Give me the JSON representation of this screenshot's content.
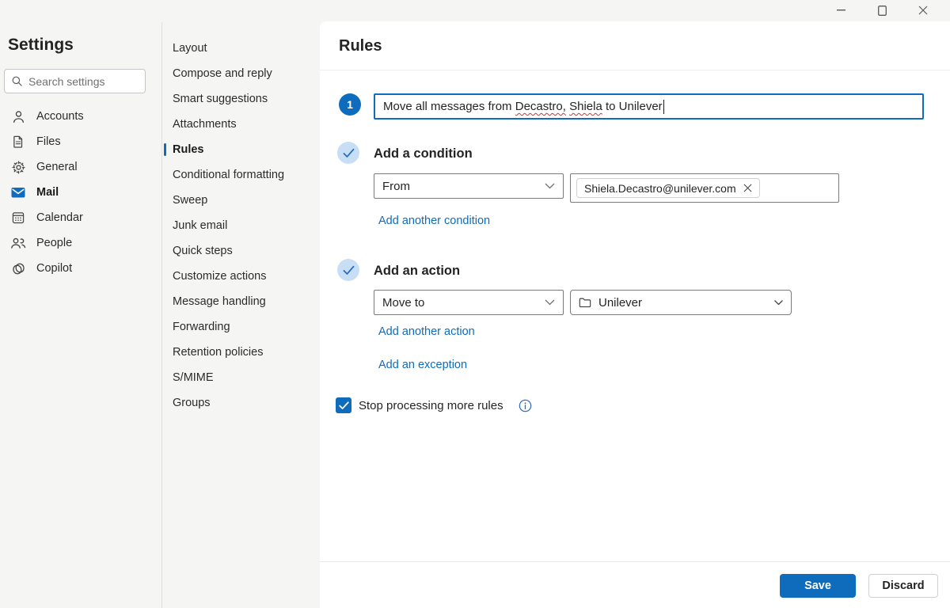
{
  "window": {
    "controls": [
      "minimize",
      "maximize",
      "close"
    ]
  },
  "settings_nav": {
    "title": "Settings",
    "search_placeholder": "Search settings",
    "items": [
      {
        "label": "Accounts",
        "icon": "person-icon",
        "selected": false
      },
      {
        "label": "Files",
        "icon": "file-icon",
        "selected": false
      },
      {
        "label": "General",
        "icon": "gear-icon",
        "selected": false
      },
      {
        "label": "Mail",
        "icon": "mail-icon",
        "selected": true
      },
      {
        "label": "Calendar",
        "icon": "calendar-icon",
        "selected": false
      },
      {
        "label": "People",
        "icon": "people-icon",
        "selected": false
      },
      {
        "label": "Copilot",
        "icon": "copilot-icon",
        "selected": false
      }
    ]
  },
  "mail_nav": {
    "items": [
      "Layout",
      "Compose and reply",
      "Smart suggestions",
      "Attachments",
      "Rules",
      "Conditional formatting",
      "Sweep",
      "Junk email",
      "Quick steps",
      "Customize actions",
      "Message handling",
      "Forwarding",
      "Retention policies",
      "S/MIME",
      "Groups"
    ],
    "selected": "Rules"
  },
  "main": {
    "title": "Rules",
    "rule": {
      "step_number": "1",
      "name_full": "Move all messages from Decastro, Shiela to Unilever",
      "name_parts": [
        {
          "text": "Move all messages from ",
          "misspelled": false
        },
        {
          "text": "Decastro,",
          "misspelled": true
        },
        {
          "text": " ",
          "misspelled": false
        },
        {
          "text": "Shiela",
          "misspelled": true
        },
        {
          "text": " to Unilever",
          "misspelled": false
        }
      ],
      "condition": {
        "heading": "Add a condition",
        "field_selected": "From",
        "value_chip": "Shiela.Decastro@unilever.com",
        "add_link": "Add another condition"
      },
      "action": {
        "heading": "Add an action",
        "field_selected": "Move to",
        "folder_selected": "Unilever",
        "add_link": "Add another action"
      },
      "exception_link": "Add an exception",
      "stop_processing": {
        "label": "Stop processing more rules",
        "checked": true
      }
    },
    "footer": {
      "save": "Save",
      "discard": "Discard"
    }
  },
  "colors": {
    "accent": "#0f6cbd",
    "link": "#0f6cbd",
    "check_circle_bg": "#c7def5",
    "misspell_red": "#d13438",
    "background": "#f5f5f4",
    "panel": "#ffffff"
  }
}
